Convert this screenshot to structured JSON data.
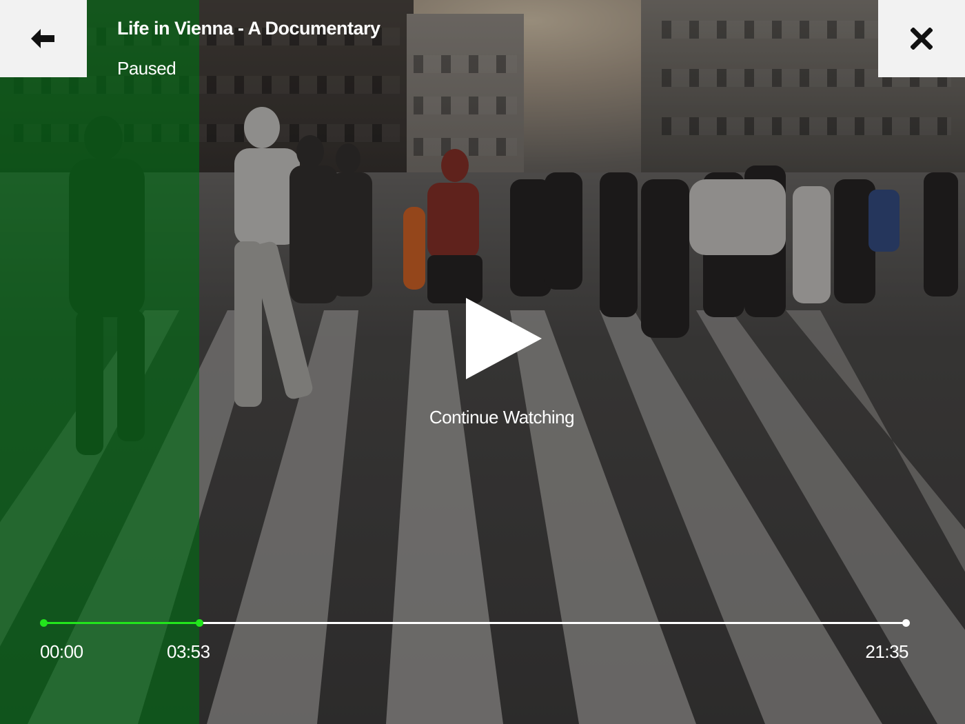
{
  "player": {
    "title": "Life in Vienna - A Documentary",
    "status": "Paused",
    "continue_label": "Continue Watching",
    "progress_fraction": 0.18,
    "accent_color": "#22e61c",
    "tint_color": "#006e14"
  },
  "toolbar": {
    "back_icon": "arrow-left-icon",
    "close_icon": "close-icon"
  },
  "center": {
    "play_icon": "play-icon"
  },
  "timeline": {
    "start_time": "00:00",
    "current_time": "03:53",
    "end_time": "21:35"
  }
}
